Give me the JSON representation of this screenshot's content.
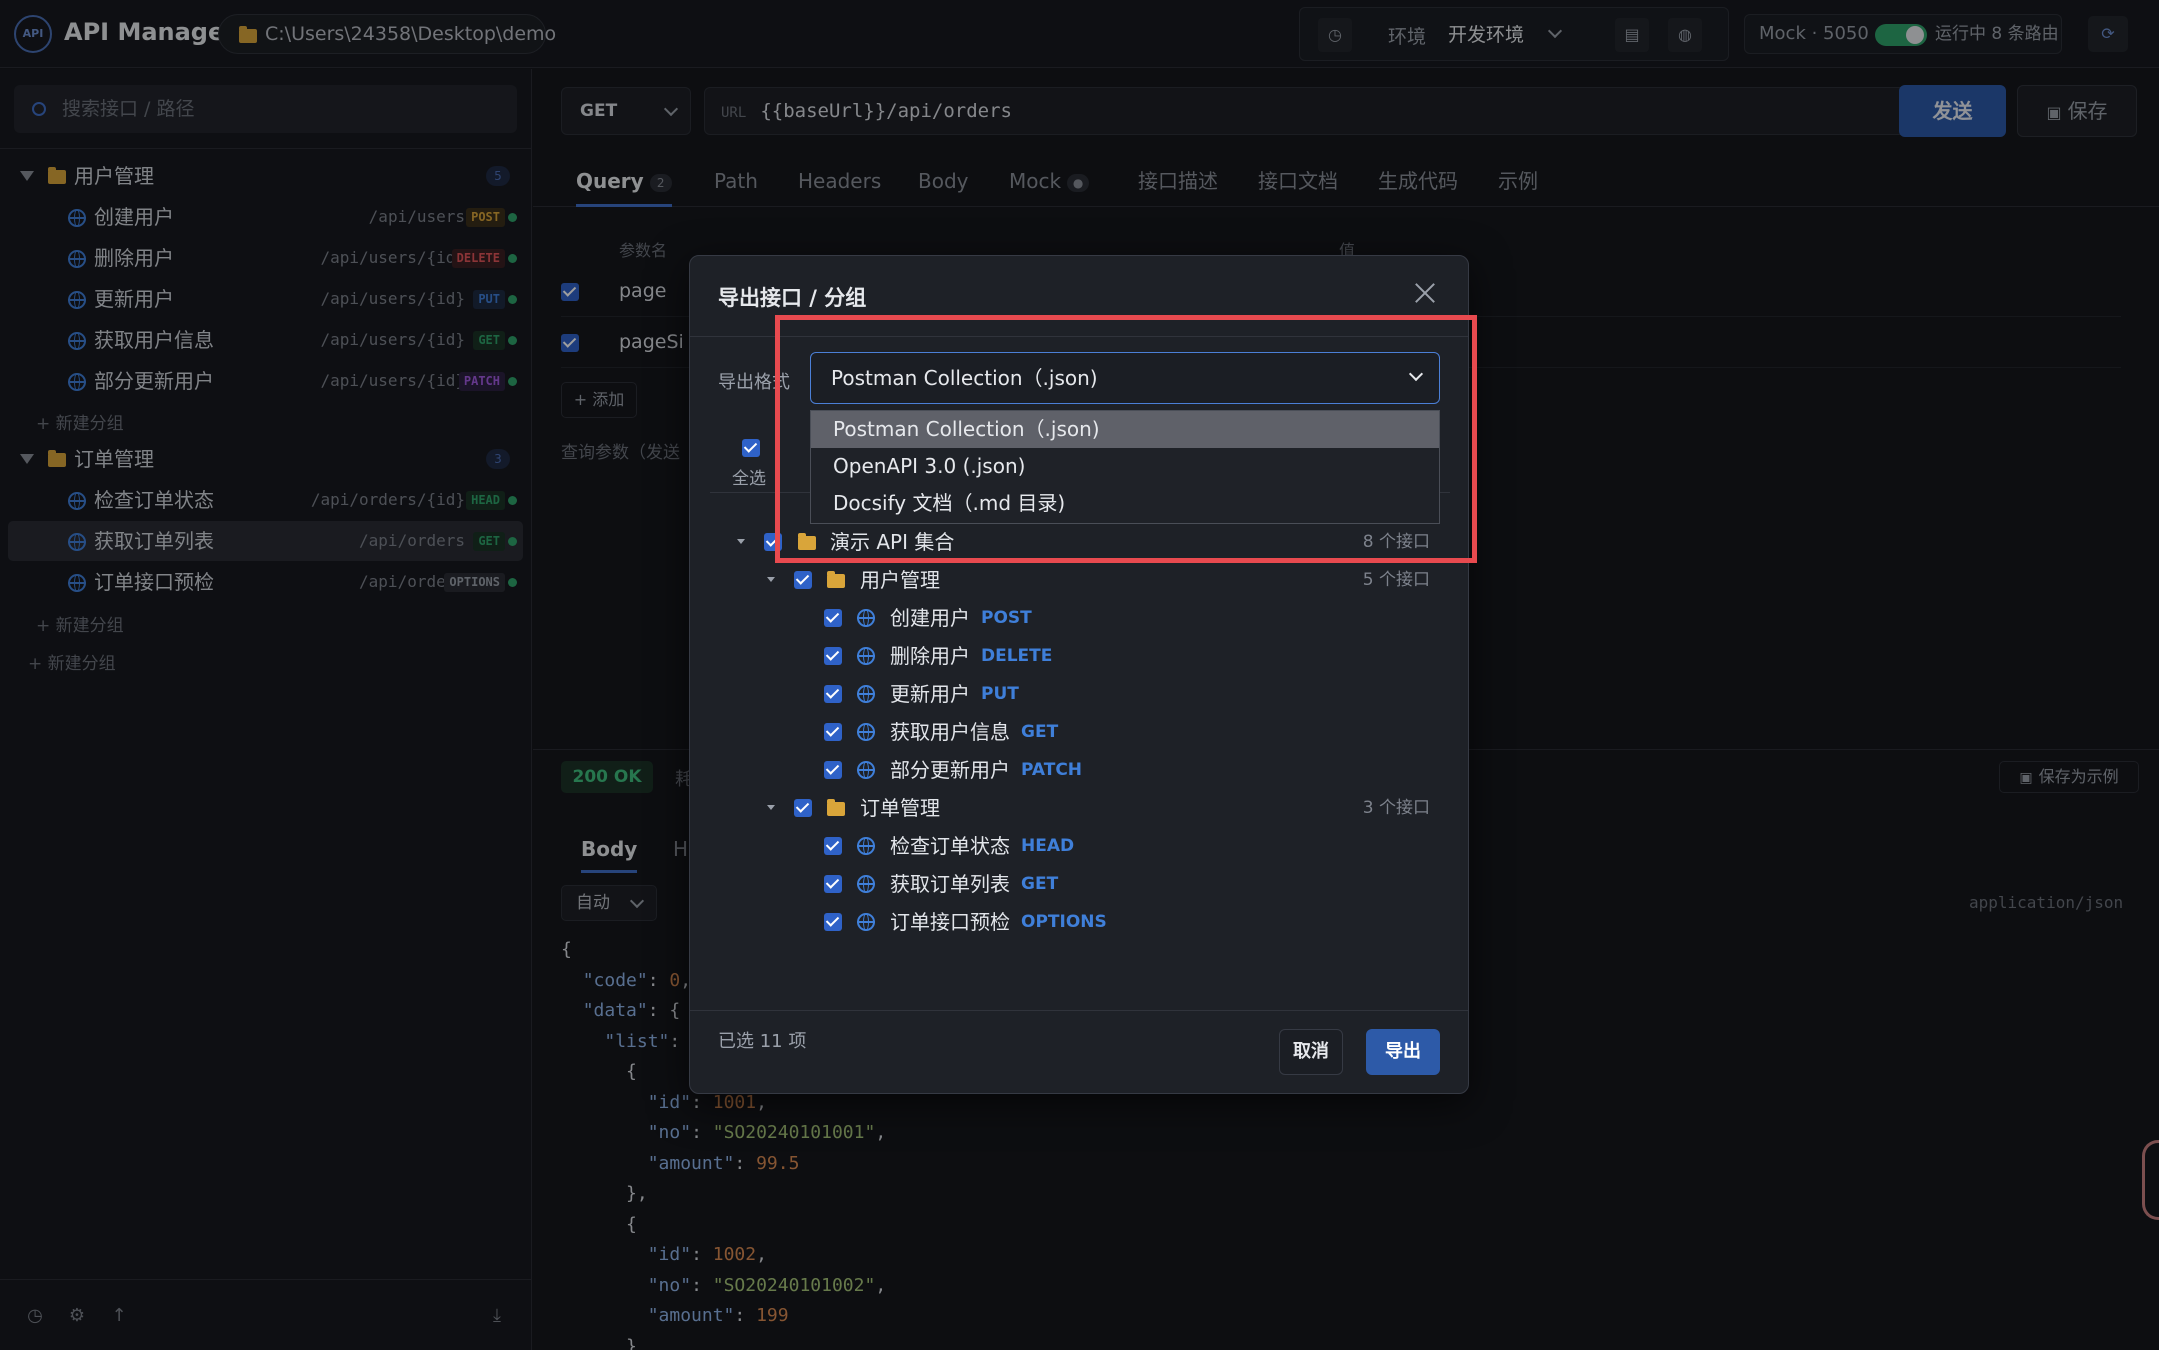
{
  "app": {
    "logo_text": "API",
    "title": "API Manager",
    "path": "C:\\Users\\24358\\Desktop\\demo"
  },
  "topbar": {
    "env_label": "环境",
    "env_value": "开发环境",
    "mock_label": "Mock · 5050",
    "mock_status": "运行中 8 条路由"
  },
  "sidebar": {
    "search_placeholder": "搜索接口 / 路径",
    "groups": [
      {
        "name": "用户管理",
        "count": "5",
        "items": [
          {
            "label": "创建用户",
            "path": "/api/users",
            "method": "POST"
          },
          {
            "label": "删除用户",
            "path": "/api/users/{id}",
            "method": "DELETE"
          },
          {
            "label": "更新用户",
            "path": "/api/users/{id}",
            "method": "PUT"
          },
          {
            "label": "获取用户信息",
            "path": "/api/users/{id}",
            "method": "GET"
          },
          {
            "label": "部分更新用户",
            "path": "/api/users/{id}",
            "method": "PATCH"
          }
        ]
      },
      {
        "name": "订单管理",
        "count": "3",
        "items": [
          {
            "label": "检查订单状态",
            "path": "/api/orders/{id}",
            "method": "HEAD"
          },
          {
            "label": "获取订单列表",
            "path": "/api/orders",
            "method": "GET"
          },
          {
            "label": "订单接口预检",
            "path": "/api/orders",
            "method": "OPTIONS"
          }
        ]
      }
    ],
    "new_group": "+ 新建分组"
  },
  "request": {
    "method": "GET",
    "url_prefix": "URL",
    "url": "{{baseUrl}}/api/orders",
    "send": "发送",
    "save": "保存",
    "tabs": [
      "Query",
      "Path",
      "Headers",
      "Body",
      "Mock",
      "接口描述",
      "接口文档",
      "生成代码",
      "示例"
    ],
    "query_badge": "2",
    "mock_badge": "●",
    "param_header": "参数名",
    "value_header": "值",
    "params": [
      "page",
      "pageSi"
    ],
    "add_label": "+ 添加",
    "hint": "查询参数（发送"
  },
  "response": {
    "status": "200 OK",
    "status_extra": "耗",
    "save_example": "保存为示例",
    "tabs": [
      "Body",
      "H"
    ],
    "format": "自动",
    "content_type": "application/json",
    "code_lines": [
      "{",
      "  \"code\": 0,",
      "  \"data\": {",
      "    \"list\":",
      "      {",
      "        \"id\": 1001,",
      "        \"no\": \"SO20240101001\",",
      "        \"amount\": 99.5",
      "      },",
      "      {",
      "        \"id\": 1002,",
      "        \"no\": \"SO20240101002\",",
      "        \"amount\": 199",
      "      }"
    ]
  },
  "dialog": {
    "title": "导出接口 / 分组",
    "format_label": "导出格式",
    "format_value": "Postman Collection（.json)",
    "options": [
      "Postman Collection（.json)",
      "OpenAPI 3.0 (.json)",
      "Docsify 文档（.md 目录)"
    ],
    "select_all": "全选",
    "tree": {
      "root": {
        "name": "演示 API 集合",
        "count": "8 个接口"
      },
      "groups": [
        {
          "name": "用户管理",
          "count": "5 个接口",
          "items": [
            {
              "label": "创建用户",
              "method": "POST"
            },
            {
              "label": "删除用户",
              "method": "DELETE"
            },
            {
              "label": "更新用户",
              "method": "PUT"
            },
            {
              "label": "获取用户信息",
              "method": "GET"
            },
            {
              "label": "部分更新用户",
              "method": "PATCH"
            }
          ]
        },
        {
          "name": "订单管理",
          "count": "3 个接口",
          "items": [
            {
              "label": "检查订单状态",
              "method": "HEAD"
            },
            {
              "label": "获取订单列表",
              "method": "GET"
            },
            {
              "label": "订单接口预检",
              "method": "OPTIONS"
            }
          ]
        }
      ]
    },
    "selected_count": "已选 11 项",
    "cancel": "取消",
    "export": "导出"
  },
  "colors": {
    "accent": "#2d5aa8",
    "highlight": "#e84a4f",
    "method_post": "#d9a53a",
    "method_delete": "#e0555a",
    "method_put": "#3f7fd9",
    "method_get": "#2fa36b",
    "method_patch": "#a25be0",
    "method_head": "#2fa36b",
    "method_options": "#9aa0aa"
  }
}
